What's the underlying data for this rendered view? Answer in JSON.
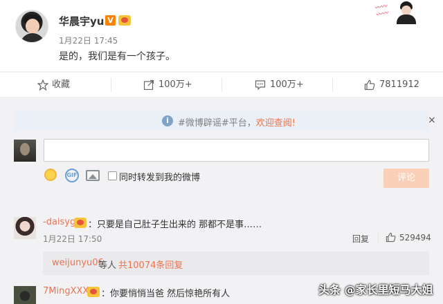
{
  "post": {
    "author": "华晨宇yu",
    "verified_mark": "V",
    "time": "1月22日 17:45",
    "text": "是的，我们是有一个孩子。"
  },
  "actions": {
    "favorite_label": "收藏",
    "repost_count": "100万+",
    "comment_count": "100万+",
    "like_count": "7811912"
  },
  "notice": {
    "icon": "i",
    "text_prefix": "#微博辟谣#平台，",
    "link_text": "欢迎查阅!",
    "close": "×"
  },
  "composer": {
    "gif_label": "GIF",
    "repost_checkbox_label": "同时转发到我的微博",
    "submit_label": "评论"
  },
  "comments": [
    {
      "user": "-daisyg",
      "text": "：只要是自己肚子生出来的 那都不是事……",
      "time": "1月22日 17:50",
      "reply_label": "回复",
      "likes": "529494",
      "replies_user": "weijunyu06",
      "replies_middle": "等人",
      "replies_count": "共10074条回复"
    },
    {
      "user": "7MingXXX",
      "text": "：你要悄悄当爸 然后惊艳所有人"
    }
  ],
  "watermark": "头条 @家长里短马大姐"
}
